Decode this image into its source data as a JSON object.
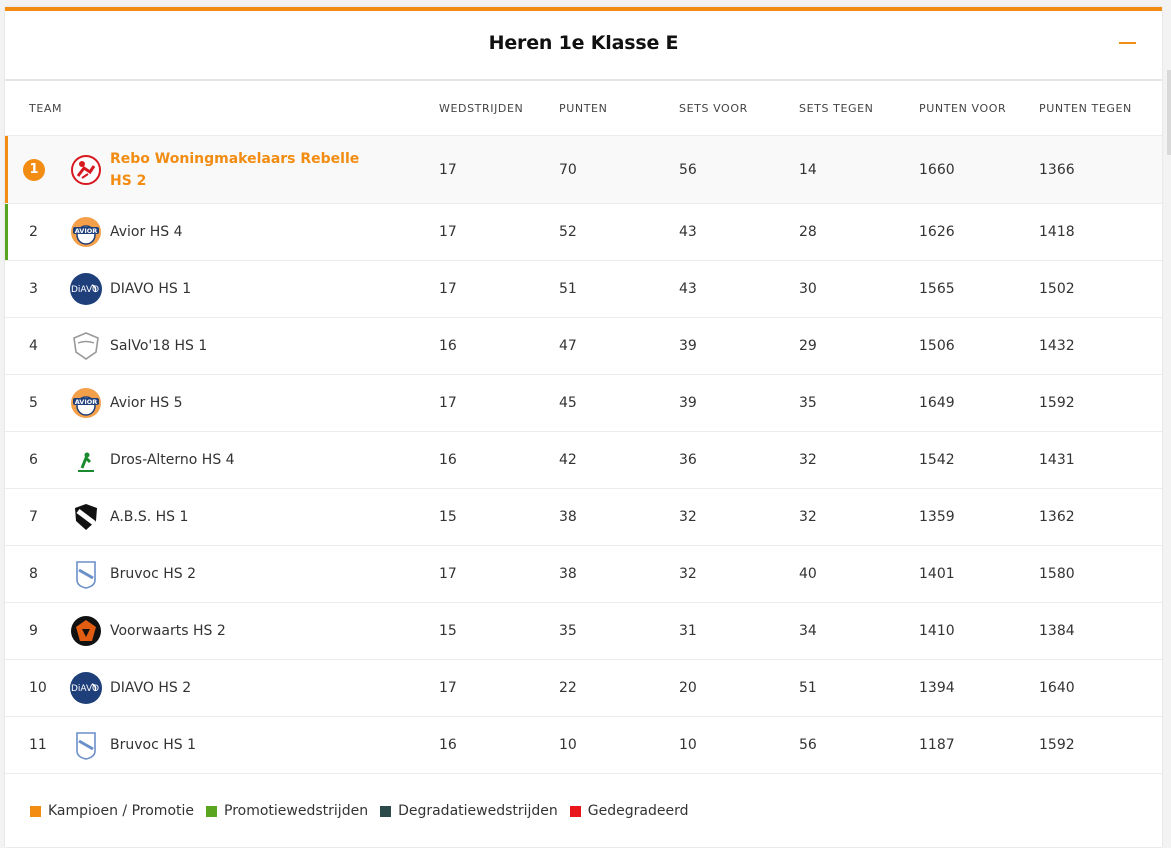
{
  "title": "Heren 1e Klasse E",
  "columns": {
    "team": "TEAM",
    "wedstrijden": "WEDSTRIJDEN",
    "punten": "PUNTEN",
    "sets_voor": "SETS VOOR",
    "sets_tegen": "SETS TEGEN",
    "punten_voor": "PUNTEN VOOR",
    "punten_tegen": "PUNTEN TEGEN"
  },
  "rows": [
    {
      "rank": "1",
      "team": "Rebo Woningmakelaars Rebelle HS 2",
      "logo": "rebelle-logo",
      "wedstrijden": "17",
      "punten": "70",
      "sets_voor": "56",
      "sets_tegen": "14",
      "punten_voor": "1660",
      "punten_tegen": "1366"
    },
    {
      "rank": "2",
      "team": "Avior HS 4",
      "logo": "avior-logo",
      "wedstrijden": "17",
      "punten": "52",
      "sets_voor": "43",
      "sets_tegen": "28",
      "punten_voor": "1626",
      "punten_tegen": "1418"
    },
    {
      "rank": "3",
      "team": "DIAVO HS 1",
      "logo": "diavo-logo",
      "wedstrijden": "17",
      "punten": "51",
      "sets_voor": "43",
      "sets_tegen": "30",
      "punten_voor": "1565",
      "punten_tegen": "1502"
    },
    {
      "rank": "4",
      "team": "SalVo'18 HS 1",
      "logo": "salvo-shield-logo",
      "wedstrijden": "16",
      "punten": "47",
      "sets_voor": "39",
      "sets_tegen": "29",
      "punten_voor": "1506",
      "punten_tegen": "1432"
    },
    {
      "rank": "5",
      "team": "Avior HS 5",
      "logo": "avior-logo",
      "wedstrijden": "17",
      "punten": "45",
      "sets_voor": "39",
      "sets_tegen": "35",
      "punten_voor": "1649",
      "punten_tegen": "1592"
    },
    {
      "rank": "6",
      "team": "Dros-Alterno HS 4",
      "logo": "dros-alterno-logo",
      "wedstrijden": "16",
      "punten": "42",
      "sets_voor": "36",
      "sets_tegen": "32",
      "punten_voor": "1542",
      "punten_tegen": "1431"
    },
    {
      "rank": "7",
      "team": "A.B.S. HS 1",
      "logo": "abs-logo",
      "wedstrijden": "15",
      "punten": "38",
      "sets_voor": "32",
      "sets_tegen": "32",
      "punten_voor": "1359",
      "punten_tegen": "1362"
    },
    {
      "rank": "8",
      "team": "Bruvoc HS 2",
      "logo": "bruvoc-logo",
      "wedstrijden": "17",
      "punten": "38",
      "sets_voor": "32",
      "sets_tegen": "40",
      "punten_voor": "1401",
      "punten_tegen": "1580"
    },
    {
      "rank": "9",
      "team": "Voorwaarts HS 2",
      "logo": "voorwaarts-logo",
      "wedstrijden": "15",
      "punten": "35",
      "sets_voor": "31",
      "sets_tegen": "34",
      "punten_voor": "1410",
      "punten_tegen": "1384"
    },
    {
      "rank": "10",
      "team": "DIAVO HS 2",
      "logo": "diavo-logo",
      "wedstrijden": "17",
      "punten": "22",
      "sets_voor": "20",
      "sets_tegen": "51",
      "punten_voor": "1394",
      "punten_tegen": "1640"
    },
    {
      "rank": "11",
      "team": "Bruvoc HS 1",
      "logo": "bruvoc-logo",
      "wedstrijden": "16",
      "punten": "10",
      "sets_voor": "10",
      "sets_tegen": "56",
      "punten_voor": "1187",
      "punten_tegen": "1592"
    }
  ],
  "legend": [
    {
      "label": "Kampioen / Promotie",
      "color": "#f28c12"
    },
    {
      "label": "Promotiewedstrijden",
      "color": "#5aa51f"
    },
    {
      "label": "Degradatiewedstrijden",
      "color": "#2c4a4a"
    },
    {
      "label": "Gedegradeerd",
      "color": "#e8151b"
    }
  ],
  "colors": {
    "accent": "#f28c12",
    "promotion": "#5aa51f"
  }
}
